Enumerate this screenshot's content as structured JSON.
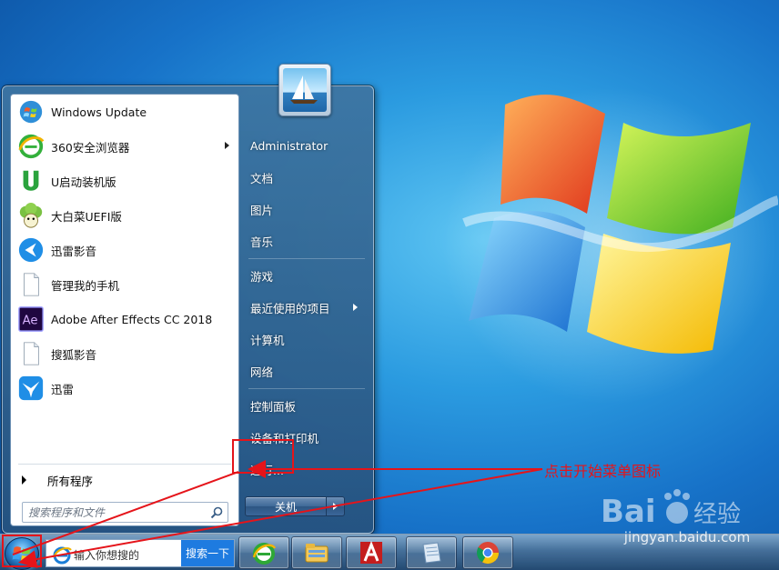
{
  "start_menu": {
    "programs": [
      {
        "label": "Windows Update",
        "icon": "windows-update-icon",
        "submenu": false
      },
      {
        "label": "360安全浏览器",
        "icon": "browser-360-icon",
        "submenu": true
      },
      {
        "label": "U启动装机版",
        "icon": "u-qidong-icon",
        "submenu": false
      },
      {
        "label": "大白菜UEFI版",
        "icon": "dabaicai-icon",
        "submenu": false
      },
      {
        "label": "迅雷影音",
        "icon": "xunlei-player-icon",
        "submenu": false
      },
      {
        "label": "管理我的手机",
        "icon": "blank-document-icon",
        "submenu": false
      },
      {
        "label": "Adobe After Effects CC 2018",
        "icon": "after-effects-icon",
        "submenu": false
      },
      {
        "label": "搜狐影音",
        "icon": "blank-document-icon",
        "submenu": false
      },
      {
        "label": "迅雷",
        "icon": "xunlei-icon",
        "submenu": false
      }
    ],
    "all_programs": "所有程序",
    "search_placeholder": "搜索程序和文件",
    "right_items": {
      "user": "Administrator",
      "documents": "文档",
      "pictures": "图片",
      "music": "音乐",
      "games": "游戏",
      "recent": "最近使用的项目",
      "computer": "计算机",
      "network": "网络",
      "control_panel": "控制面板",
      "devices": "设备和打印机",
      "run": "运行..."
    },
    "shutdown_label": "关机"
  },
  "taskbar": {
    "search_text": "输入你想搜的",
    "search_button": "搜索一下",
    "pinned": [
      "ie-browser-icon",
      "folder-icon",
      "autocad-icon",
      "notepad-icon",
      "chrome-icon"
    ]
  },
  "annotation": {
    "note": "点击开始菜单图标",
    "color": "#e5141a"
  },
  "watermark": {
    "brand": "Baidu经验",
    "url": "jingyan.baidu.com"
  }
}
